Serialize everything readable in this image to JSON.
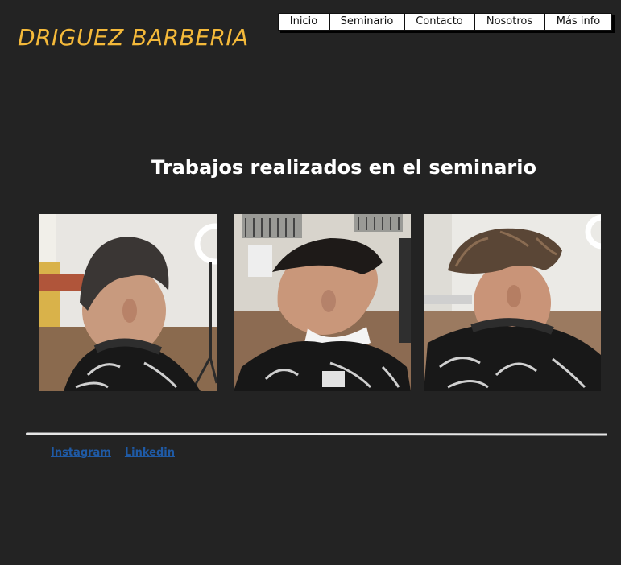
{
  "header": {
    "brand": "DRIGUEZ BARBERIA",
    "nav": [
      "Inicio",
      "Seminario",
      "Contacto",
      "Nosotros",
      "Más info"
    ]
  },
  "main": {
    "title": "Trabajos realizados en el seminario",
    "photos": [
      "haircut-photo-1",
      "haircut-photo-2",
      "haircut-photo-3"
    ]
  },
  "footer": {
    "links": [
      "Instagram",
      "Linkedin"
    ]
  },
  "colors": {
    "background": "#232323",
    "brand": "#f4b93a",
    "nav_background": "#ffffff",
    "link": "#1f5aa5"
  }
}
